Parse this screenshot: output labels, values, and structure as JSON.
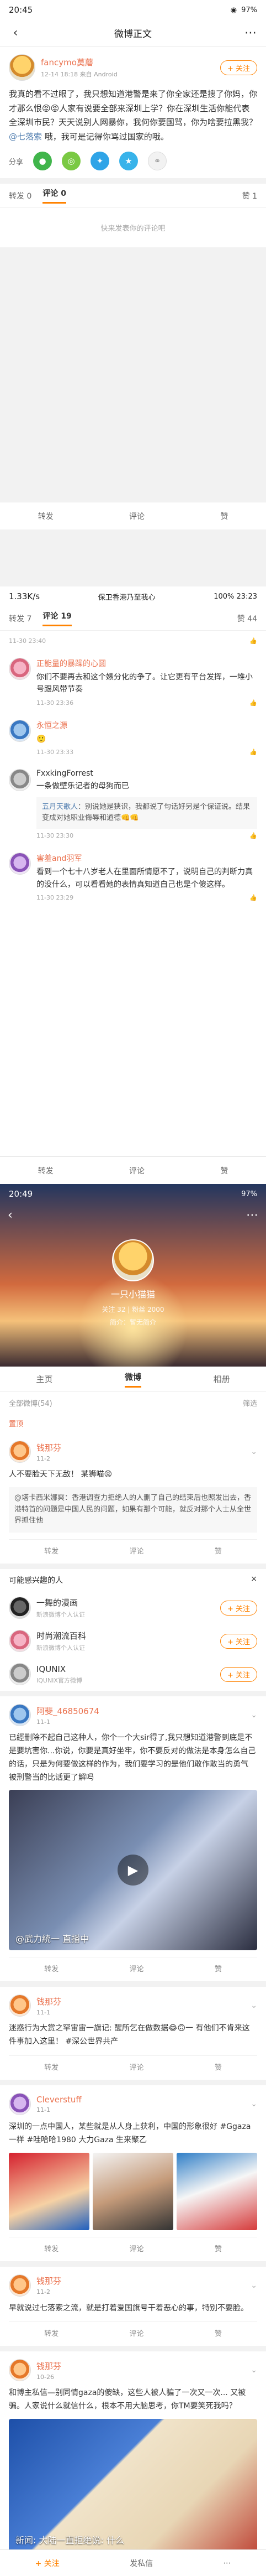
{
  "status1": {
    "time": "20:45",
    "right": "97%"
  },
  "nav1": {
    "title": "微博正文"
  },
  "post": {
    "author": "fancymo莫蘑",
    "meta": "12-14 18:18  来自 Android",
    "follow": "+ 关注",
    "text": "我真的看不过眼了，我只想知道港警是来了你全家还是搜了你妈，你才那么恨😡😡人家有说要全部来深圳上学？你在深圳生活你能代表全深圳市民？天天说别人网暴你，我何你要国骂，你为啥要拉黑我？",
    "mention": "@七落索",
    "text_tail": "哦，我可是记得你骂过国家的哦。",
    "share_label": "分享"
  },
  "bar1": {
    "repost": "转发 0",
    "comment": "评论 0",
    "like": "赞 1"
  },
  "empty1": "快来发表你的评论吧",
  "bottom1": {
    "repost": "转发",
    "comment": "评论",
    "like": "赞"
  },
  "status2": {
    "left": "1.33K/s",
    "center": "保卫香港乃至我心",
    "right": "100% 23:23"
  },
  "tabs2": {
    "repost": "转发 7",
    "comment": "评论 19",
    "like": "赞 44"
  },
  "comments": [
    {
      "name": "",
      "text": "",
      "time": "11-30 23:40"
    },
    {
      "name": "正能量的暴躁的心圆",
      "text": "你们不要再去和这个婊分化的争了。让它更有平台发挥，一堆小号跟风带节奏",
      "time": "11-30 23:36"
    },
    {
      "name": "永恒之源",
      "text": "",
      "time": "11-30 23:33"
    },
    {
      "name": "FxxkingForrest",
      "text": "一条做壁乐记者的母狗而已",
      "time": "11-30 23:30",
      "reply_name": "五月天歌人",
      "reply_text": "：别说她是狭识，我都说了句话好另是个保证说。结果变成对她职业侮辱和道德👊👊"
    },
    {
      "name": "害羞and羽军",
      "text": "看到一个七十八岁老人在里面所情愿不了，说明自己的判断力真的没什么，可以看看她的表情真知道自己也是个傻这样。",
      "time": "11-30 23:29"
    }
  ],
  "bottom2": {
    "repost": "转发",
    "comment": "评论",
    "like": "赞"
  },
  "status3": {
    "time": "20:49",
    "right": "97%"
  },
  "profile": {
    "name": "一只小猫猫",
    "stats": "关注 32  |  粉丝 2000",
    "desc": "简介：暂无简介",
    "tabs": [
      "主页",
      "微博",
      "相册"
    ],
    "filter_left": "全部微博(54)",
    "filter_right": "筛选",
    "pinned": "置顶"
  },
  "cards": [
    {
      "name": "钱那芬",
      "meta": "11-2",
      "text": "人不要脸天下无敌！ 某狮喵😡"
    },
    {
      "name": "",
      "meta": "",
      "text": "@塔卡西米娜爽：香港调查力拒绝人的人删了自己的结束后也照发出去，香港特首的问题是中国人民的问题，如果有那个可能，就反对那个人士从全世界抓住他"
    },
    {
      "name": "阿斐_46850674",
      "meta": "11-1",
      "text": "已經删除不起自己这种人，你个一个大sir得了,我只想知道港警到底是不是要坑害你...你说，你要是真好坐牢，你不要反对的做法是本身怎么自己的话，只是为何要做这样的作为，我们要学习的是他们敢作敢当的勇气 被刑警当的比话更了解吗"
    },
    {
      "name": "钱那芬",
      "meta": "11-1",
      "text": "迷惑行为大赏之罕宙宙一旗记: 醒所乞在做数据😂🙃一 有他们不肯来这件事加入这里！ #深公世界共产"
    },
    {
      "name": "Cleverstuff",
      "meta": "11-1",
      "text": "深圳的一点中国人，某些就是从人身上获利，中国的形象很好 #Ggaza一样 #哇哈哈1980 大力Gaza 生来聚乙"
    },
    {
      "name": "钱那芬",
      "meta": "11-2",
      "text": "早就说过七落索之流，就是打着爱国旗号干着恶心的事，特别不要脸。"
    },
    {
      "name": "钱那芬",
      "meta": "10-26",
      "text": "和博主私信—别同情gaza的傻缺，这些人被人骗了一次又一次... 又被骗。人家说什么就信什么，根本不用大脑思考，你TM要笑死我吗？"
    }
  ],
  "rec": {
    "header": "可能感兴趣的人",
    "close": "×",
    "items": [
      {
        "name": "一舞的漫画",
        "desc": "新浪微博个人认证"
      },
      {
        "name": "时尚潮流百科",
        "desc": "新浪微博个人认证"
      },
      {
        "name": "IQUNIX",
        "desc": "IQUNIX官方微博"
      }
    ],
    "follow": "+ 关注"
  },
  "media": {
    "caption": "@武力統一 直播中",
    "news_caption": "新闻: 大陆一直拒绝说: 什么",
    "video_label": "▶"
  },
  "actions": {
    "repost": "转发",
    "comment": "评论",
    "like": "赞"
  },
  "bottom3": {
    "follow": "+ 关注",
    "message": "发私信",
    "more": "⋯"
  }
}
